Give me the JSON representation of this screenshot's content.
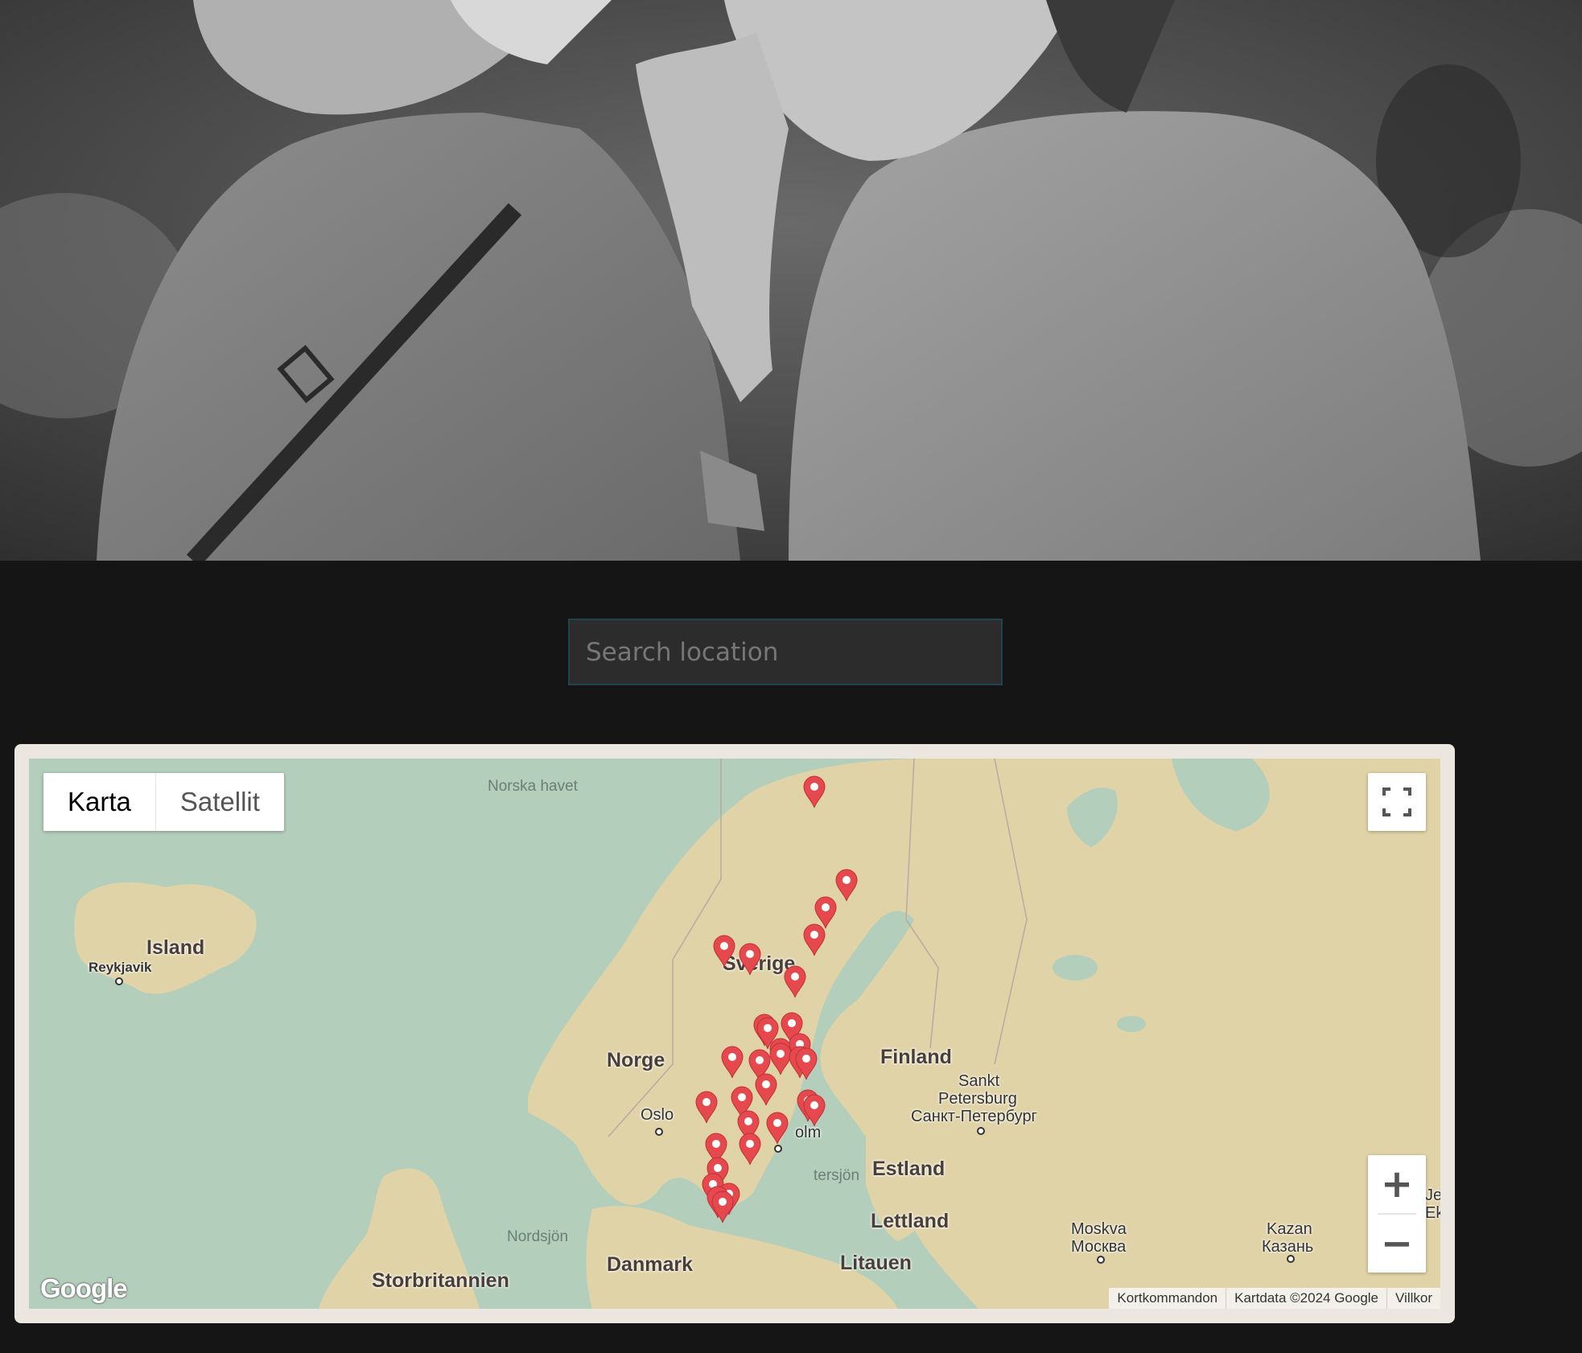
{
  "search": {
    "placeholder": "Search location"
  },
  "map": {
    "type_control": {
      "map_label": "Karta",
      "satellite_label": "Satellit"
    },
    "labels": {
      "norska_havet": "Norska havet",
      "island": "Island",
      "reykjavik": "Reykjavik",
      "sverige": "Sverige",
      "norge": "Norge",
      "finland": "Finland",
      "sankt_line1": "Sankt",
      "sankt_line2": "Petersburg",
      "sankt_line3": "Санкт-Петербург",
      "oslo": "Oslo",
      "stockholm_partial": "olm",
      "ostersjon_partial": "tersjön",
      "estland": "Estland",
      "lettland": "Lettland",
      "litauen": "Litauen",
      "nordsjon": "Nordsjön",
      "danmark": "Danmark",
      "storbritannien": "Storbritannien",
      "moskva": "Moskva",
      "moskva_ru": "Москва",
      "kazan": "Kazan",
      "kazan_ru": "Казань",
      "edge_partial_1": "Je",
      "edge_partial_2": "Ek"
    },
    "google_logo": "Google",
    "attribution": {
      "shortcuts": "Kortkommandon",
      "data": "Kartdata ©2024 Google",
      "terms": "Villkor"
    },
    "zoom_in": "+",
    "zoom_out": "−",
    "marker_color": "#e5484d"
  }
}
